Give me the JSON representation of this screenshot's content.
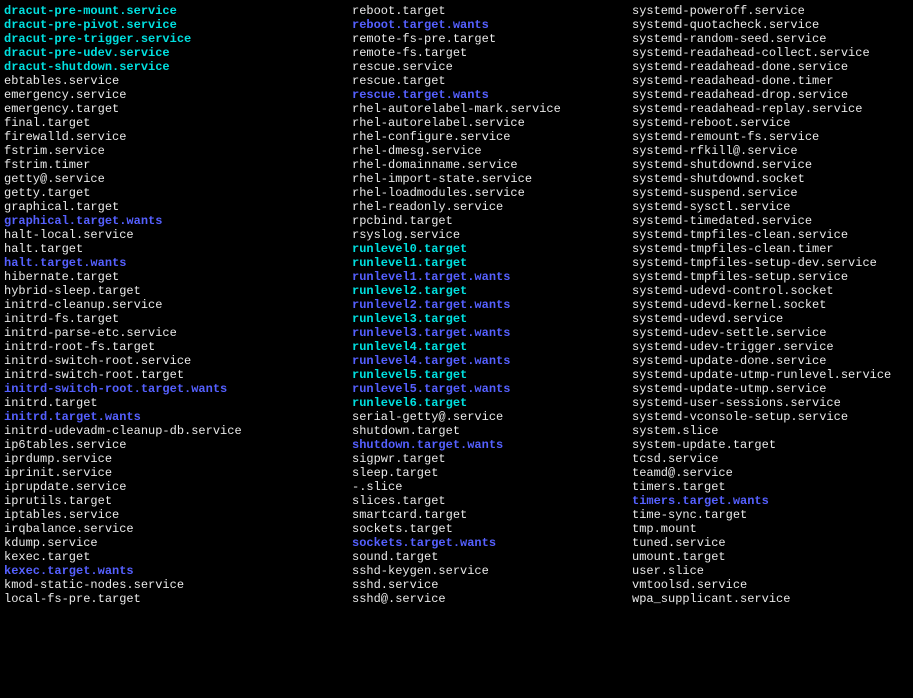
{
  "listing": [
    {
      "c1": {
        "text": "dracut-pre-mount.service",
        "cls": "cyan"
      },
      "c2": {
        "text": "reboot.target",
        "cls": "white"
      },
      "c3": {
        "text": "systemd-poweroff.service",
        "cls": "white"
      }
    },
    {
      "c1": {
        "text": "dracut-pre-pivot.service",
        "cls": "cyan"
      },
      "c2": {
        "text": "reboot.target.wants",
        "cls": "blue"
      },
      "c3": {
        "text": "systemd-quotacheck.service",
        "cls": "white"
      }
    },
    {
      "c1": {
        "text": "dracut-pre-trigger.service",
        "cls": "cyan"
      },
      "c2": {
        "text": "remote-fs-pre.target",
        "cls": "white"
      },
      "c3": {
        "text": "systemd-random-seed.service",
        "cls": "white"
      }
    },
    {
      "c1": {
        "text": "dracut-pre-udev.service",
        "cls": "cyan"
      },
      "c2": {
        "text": "remote-fs.target",
        "cls": "white"
      },
      "c3": {
        "text": "systemd-readahead-collect.service",
        "cls": "white"
      }
    },
    {
      "c1": {
        "text": "dracut-shutdown.service",
        "cls": "cyan"
      },
      "c2": {
        "text": "rescue.service",
        "cls": "white"
      },
      "c3": {
        "text": "systemd-readahead-done.service",
        "cls": "white"
      }
    },
    {
      "c1": {
        "text": "ebtables.service",
        "cls": "white"
      },
      "c2": {
        "text": "rescue.target",
        "cls": "white"
      },
      "c3": {
        "text": "systemd-readahead-done.timer",
        "cls": "white"
      }
    },
    {
      "c1": {
        "text": "emergency.service",
        "cls": "white"
      },
      "c2": {
        "text": "rescue.target.wants",
        "cls": "blue"
      },
      "c3": {
        "text": "systemd-readahead-drop.service",
        "cls": "white"
      }
    },
    {
      "c1": {
        "text": "emergency.target",
        "cls": "white"
      },
      "c2": {
        "text": "rhel-autorelabel-mark.service",
        "cls": "white"
      },
      "c3": {
        "text": "systemd-readahead-replay.service",
        "cls": "white"
      }
    },
    {
      "c1": {
        "text": "final.target",
        "cls": "white"
      },
      "c2": {
        "text": "rhel-autorelabel.service",
        "cls": "white"
      },
      "c3": {
        "text": "systemd-reboot.service",
        "cls": "white"
      }
    },
    {
      "c1": {
        "text": "firewalld.service",
        "cls": "white"
      },
      "c2": {
        "text": "rhel-configure.service",
        "cls": "white"
      },
      "c3": {
        "text": "systemd-remount-fs.service",
        "cls": "white"
      }
    },
    {
      "c1": {
        "text": "fstrim.service",
        "cls": "white"
      },
      "c2": {
        "text": "rhel-dmesg.service",
        "cls": "white"
      },
      "c3": {
        "text": "systemd-rfkill@.service",
        "cls": "white"
      }
    },
    {
      "c1": {
        "text": "fstrim.timer",
        "cls": "white"
      },
      "c2": {
        "text": "rhel-domainname.service",
        "cls": "white"
      },
      "c3": {
        "text": "systemd-shutdownd.service",
        "cls": "white"
      }
    },
    {
      "c1": {
        "text": "getty@.service",
        "cls": "white"
      },
      "c2": {
        "text": "rhel-import-state.service",
        "cls": "white"
      },
      "c3": {
        "text": "systemd-shutdownd.socket",
        "cls": "white"
      }
    },
    {
      "c1": {
        "text": "getty.target",
        "cls": "white"
      },
      "c2": {
        "text": "rhel-loadmodules.service",
        "cls": "white"
      },
      "c3": {
        "text": "systemd-suspend.service",
        "cls": "white"
      }
    },
    {
      "c1": {
        "text": "graphical.target",
        "cls": "white"
      },
      "c2": {
        "text": "rhel-readonly.service",
        "cls": "white"
      },
      "c3": {
        "text": "systemd-sysctl.service",
        "cls": "white"
      }
    },
    {
      "c1": {
        "text": "graphical.target.wants",
        "cls": "blue"
      },
      "c2": {
        "text": "rpcbind.target",
        "cls": "white"
      },
      "c3": {
        "text": "systemd-timedated.service",
        "cls": "white"
      }
    },
    {
      "c1": {
        "text": "halt-local.service",
        "cls": "white"
      },
      "c2": {
        "text": "rsyslog.service",
        "cls": "white"
      },
      "c3": {
        "text": "systemd-tmpfiles-clean.service",
        "cls": "white"
      }
    },
    {
      "c1": {
        "text": "halt.target",
        "cls": "white"
      },
      "c2": {
        "text": "runlevel0.target",
        "cls": "cyan"
      },
      "c3": {
        "text": "systemd-tmpfiles-clean.timer",
        "cls": "white"
      }
    },
    {
      "c1": {
        "text": "halt.target.wants",
        "cls": "blue"
      },
      "c2": {
        "text": "runlevel1.target",
        "cls": "cyan"
      },
      "c3": {
        "text": "systemd-tmpfiles-setup-dev.service",
        "cls": "white"
      }
    },
    {
      "c1": {
        "text": "hibernate.target",
        "cls": "white"
      },
      "c2": {
        "text": "runlevel1.target.wants",
        "cls": "blue"
      },
      "c3": {
        "text": "systemd-tmpfiles-setup.service",
        "cls": "white"
      }
    },
    {
      "c1": {
        "text": "hybrid-sleep.target",
        "cls": "white"
      },
      "c2": {
        "text": "runlevel2.target",
        "cls": "cyan"
      },
      "c3": {
        "text": "systemd-udevd-control.socket",
        "cls": "white"
      }
    },
    {
      "c1": {
        "text": "initrd-cleanup.service",
        "cls": "white"
      },
      "c2": {
        "text": "runlevel2.target.wants",
        "cls": "blue"
      },
      "c3": {
        "text": "systemd-udevd-kernel.socket",
        "cls": "white"
      }
    },
    {
      "c1": {
        "text": "initrd-fs.target",
        "cls": "white"
      },
      "c2": {
        "text": "runlevel3.target",
        "cls": "cyan"
      },
      "c3": {
        "text": "systemd-udevd.service",
        "cls": "white"
      }
    },
    {
      "c1": {
        "text": "initrd-parse-etc.service",
        "cls": "white"
      },
      "c2": {
        "text": "runlevel3.target.wants",
        "cls": "blue"
      },
      "c3": {
        "text": "systemd-udev-settle.service",
        "cls": "white"
      }
    },
    {
      "c1": {
        "text": "initrd-root-fs.target",
        "cls": "white"
      },
      "c2": {
        "text": "runlevel4.target",
        "cls": "cyan"
      },
      "c3": {
        "text": "systemd-udev-trigger.service",
        "cls": "white"
      }
    },
    {
      "c1": {
        "text": "initrd-switch-root.service",
        "cls": "white"
      },
      "c2": {
        "text": "runlevel4.target.wants",
        "cls": "blue"
      },
      "c3": {
        "text": "systemd-update-done.service",
        "cls": "white"
      }
    },
    {
      "c1": {
        "text": "initrd-switch-root.target",
        "cls": "white"
      },
      "c2": {
        "text": "runlevel5.target",
        "cls": "cyan"
      },
      "c3": {
        "text": "systemd-update-utmp-runlevel.service",
        "cls": "white"
      }
    },
    {
      "c1": {
        "text": "initrd-switch-root.target.wants",
        "cls": "blue"
      },
      "c2": {
        "text": "runlevel5.target.wants",
        "cls": "blue"
      },
      "c3": {
        "text": "systemd-update-utmp.service",
        "cls": "white"
      }
    },
    {
      "c1": {
        "text": "initrd.target",
        "cls": "white"
      },
      "c2": {
        "text": "runlevel6.target",
        "cls": "cyan"
      },
      "c3": {
        "text": "systemd-user-sessions.service",
        "cls": "white"
      }
    },
    {
      "c1": {
        "text": "initrd.target.wants",
        "cls": "blue"
      },
      "c2": {
        "text": "serial-getty@.service",
        "cls": "white"
      },
      "c3": {
        "text": "systemd-vconsole-setup.service",
        "cls": "white"
      }
    },
    {
      "c1": {
        "text": "initrd-udevadm-cleanup-db.service",
        "cls": "white"
      },
      "c2": {
        "text": "shutdown.target",
        "cls": "white"
      },
      "c3": {
        "text": "system.slice",
        "cls": "white"
      }
    },
    {
      "c1": {
        "text": "ip6tables.service",
        "cls": "white"
      },
      "c2": {
        "text": "shutdown.target.wants",
        "cls": "blue"
      },
      "c3": {
        "text": "system-update.target",
        "cls": "white"
      }
    },
    {
      "c1": {
        "text": "iprdump.service",
        "cls": "white"
      },
      "c2": {
        "text": "sigpwr.target",
        "cls": "white"
      },
      "c3": {
        "text": "tcsd.service",
        "cls": "white"
      }
    },
    {
      "c1": {
        "text": "iprinit.service",
        "cls": "white"
      },
      "c2": {
        "text": "sleep.target",
        "cls": "white"
      },
      "c3": {
        "text": "teamd@.service",
        "cls": "white"
      }
    },
    {
      "c1": {
        "text": "iprupdate.service",
        "cls": "white"
      },
      "c2": {
        "text": "-.slice",
        "cls": "white"
      },
      "c3": {
        "text": "timers.target",
        "cls": "white"
      }
    },
    {
      "c1": {
        "text": "iprutils.target",
        "cls": "white"
      },
      "c2": {
        "text": "slices.target",
        "cls": "white"
      },
      "c3": {
        "text": "timers.target.wants",
        "cls": "blue"
      }
    },
    {
      "c1": {
        "text": "iptables.service",
        "cls": "white"
      },
      "c2": {
        "text": "smartcard.target",
        "cls": "white"
      },
      "c3": {
        "text": "time-sync.target",
        "cls": "white"
      }
    },
    {
      "c1": {
        "text": "irqbalance.service",
        "cls": "white"
      },
      "c2": {
        "text": "sockets.target",
        "cls": "white"
      },
      "c3": {
        "text": "tmp.mount",
        "cls": "white"
      }
    },
    {
      "c1": {
        "text": "kdump.service",
        "cls": "white"
      },
      "c2": {
        "text": "sockets.target.wants",
        "cls": "blue"
      },
      "c3": {
        "text": "tuned.service",
        "cls": "white"
      }
    },
    {
      "c1": {
        "text": "kexec.target",
        "cls": "white"
      },
      "c2": {
        "text": "sound.target",
        "cls": "white"
      },
      "c3": {
        "text": "umount.target",
        "cls": "white"
      }
    },
    {
      "c1": {
        "text": "kexec.target.wants",
        "cls": "blue"
      },
      "c2": {
        "text": "sshd-keygen.service",
        "cls": "white"
      },
      "c3": {
        "text": "user.slice",
        "cls": "white"
      }
    },
    {
      "c1": {
        "text": "kmod-static-nodes.service",
        "cls": "white"
      },
      "c2": {
        "text": "sshd.service",
        "cls": "white"
      },
      "c3": {
        "text": "vmtoolsd.service",
        "cls": "white"
      }
    },
    {
      "c1": {
        "text": "local-fs-pre.target",
        "cls": "white"
      },
      "c2": {
        "text": "sshd@.service",
        "cls": "white"
      },
      "c3": {
        "text": "wpa_supplicant.service",
        "cls": "white"
      }
    }
  ]
}
